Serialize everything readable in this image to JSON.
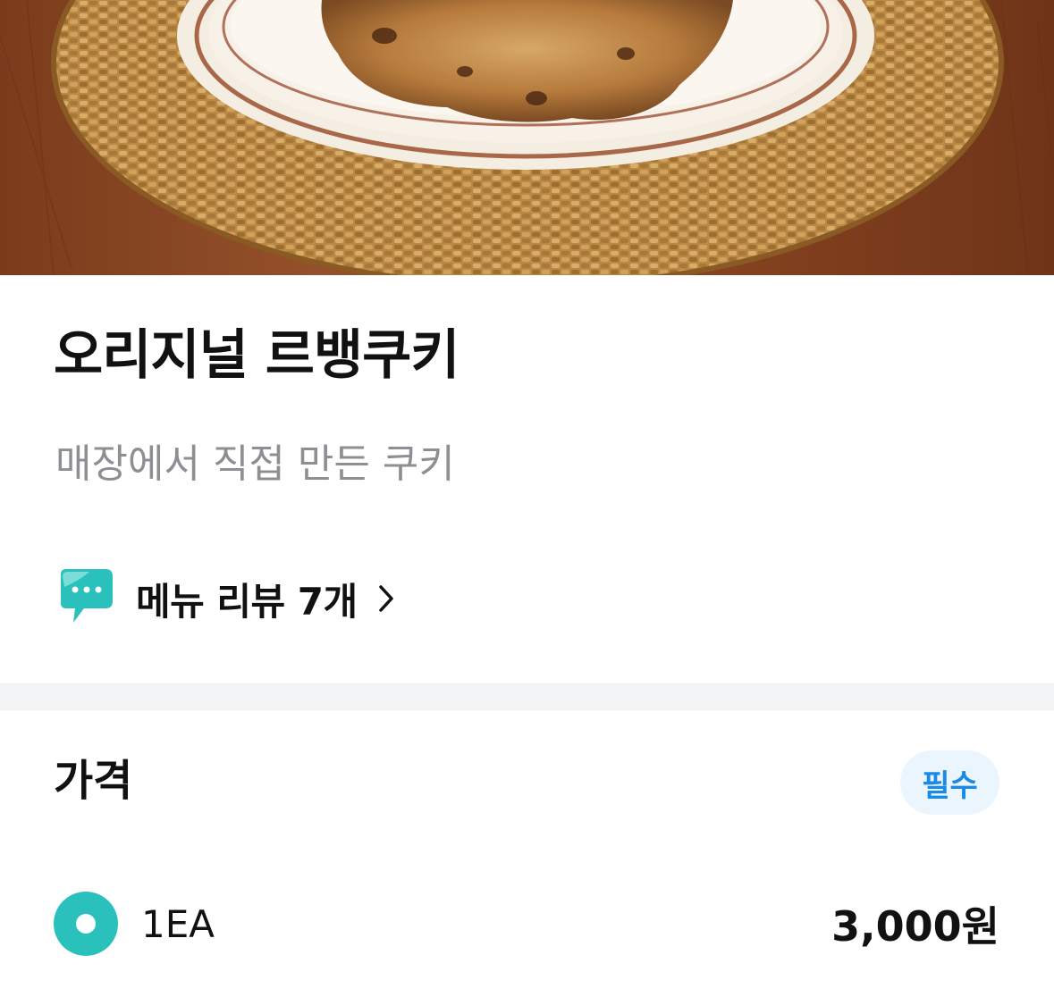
{
  "product": {
    "name": "오리지널 르뱅쿠키",
    "description": "매장에서 직접 만든 쿠키",
    "review_link": "메뉴 리뷰 7개"
  },
  "price_section": {
    "title": "가격",
    "badge": "필수",
    "options": [
      {
        "label": "1EA",
        "price": "3,000원",
        "selected": true
      }
    ]
  },
  "colors": {
    "accent": "#2ac1bc",
    "badge_text": "#1a8ae6",
    "badge_bg": "#eaf5fe",
    "divider": "#f2f4f6",
    "subtitle": "#8e8e93"
  },
  "icons": {
    "review": "speech-bubble-icon",
    "chevron": "chevron-right-icon",
    "radio": "radio-selected-icon"
  }
}
